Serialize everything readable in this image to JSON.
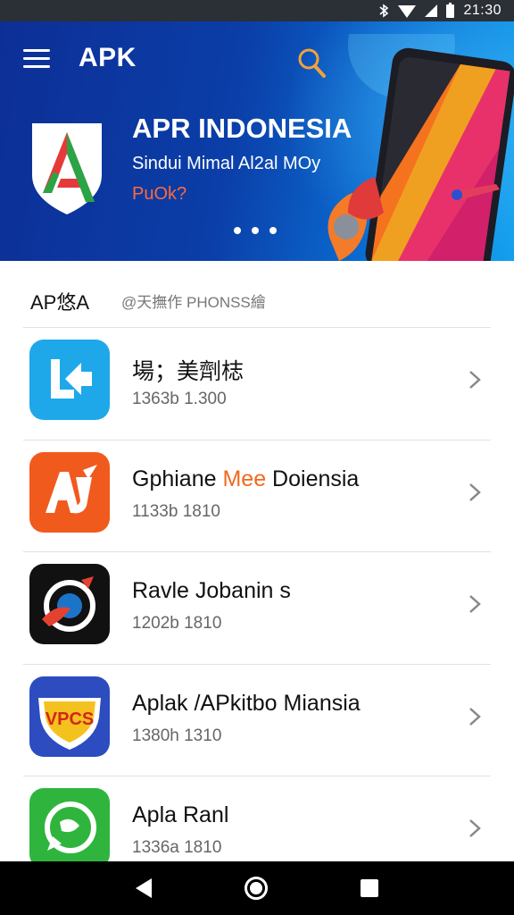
{
  "status_bar": {
    "time": "21:30",
    "icons": [
      "bluetooth-icon",
      "wifi-icon",
      "signal-icon",
      "battery-icon"
    ]
  },
  "toolbar": {
    "title": "APK",
    "menu_icon": "hamburger-menu-icon",
    "search_icon": "search-icon"
  },
  "banner": {
    "title": "APR INDONESIA",
    "subtitle": "Sindui Mimal Al2al MOy",
    "cta": "PuOk?",
    "slide_count": 3,
    "active_slide": 3,
    "background_colors": [
      "#0c2f96",
      "#14a0ee"
    ]
  },
  "section": {
    "title": "AP悠A",
    "subtitle": "@天撫作 PHONSS繪"
  },
  "apps": [
    {
      "name": "場；美劑梽",
      "meta": "1363b  1.300",
      "icon": "blue-arrow-app-icon",
      "icon_bg": "#1ea8ea"
    },
    {
      "name_before": "Gphiane ",
      "name_accent": "Mee",
      "name_after": " Doiensia",
      "meta": "1133b  1810",
      "icon": "orange-aj-app-icon",
      "icon_bg": "#f15a1d"
    },
    {
      "name": "Ravle Jobanin s",
      "meta": "1202b  1810",
      "icon": "black-target-app-icon",
      "icon_bg": "#111111"
    },
    {
      "name": "Aplak /APkitbo Miansia",
      "meta": "1380h  1310",
      "icon": "vpcs-shield-app-icon",
      "icon_bg": "#2c4cc0"
    },
    {
      "name": "Apla Ranl",
      "meta": "1336a  1810",
      "icon": "green-chat-app-icon",
      "icon_bg": "#2fb53d"
    }
  ],
  "nav_bar": {
    "icons": [
      "back-icon",
      "home-icon",
      "recents-icon"
    ]
  },
  "colors": {
    "accent_orange": "#f06a1d",
    "banner_blue": "#0b3ea8",
    "divider": "#e2e2e2"
  }
}
